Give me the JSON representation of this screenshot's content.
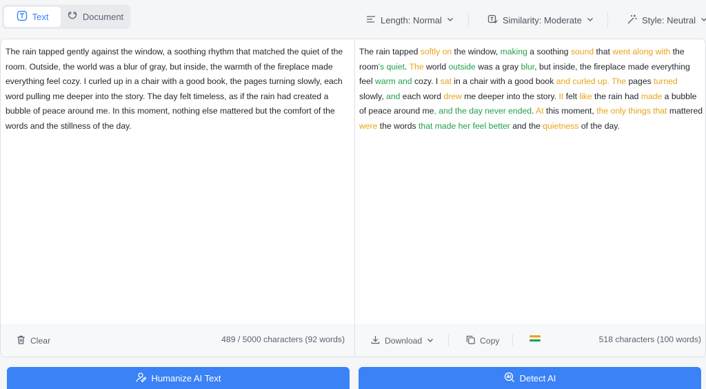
{
  "modes": {
    "text_label": "Text",
    "document_label": "Document"
  },
  "options": {
    "length": "Length: Normal",
    "similarity": "Similarity: Moderate",
    "style": "Style: Neutral"
  },
  "input": {
    "text": "The rain tapped gently against the window, a soothing rhythm that matched the quiet of the room. Outside, the world was a blur of gray, but inside, the warmth of the fireplace made everything feel cozy. I curled up in a chair with a good book, the pages turning slowly, each word pulling me deeper into the story. The day felt timeless, as if the rain had created a bubble of peace around me. In this moment, nothing else mattered but the comfort of the words and the stillness of the day.",
    "clear_label": "Clear",
    "count": "489 / 5000 characters (92 words)"
  },
  "output": {
    "segments": [
      {
        "t": "The rain tapped ",
        "c": ""
      },
      {
        "t": "softly on",
        "c": "o"
      },
      {
        "t": " the window, ",
        "c": ""
      },
      {
        "t": "making",
        "c": "g"
      },
      {
        "t": " a soothing ",
        "c": ""
      },
      {
        "t": "sound",
        "c": "o"
      },
      {
        "t": " that ",
        "c": ""
      },
      {
        "t": "went along with",
        "c": "o"
      },
      {
        "t": " the room",
        "c": ""
      },
      {
        "t": "'s quiet",
        "c": "g"
      },
      {
        "t": ". ",
        "c": ""
      },
      {
        "t": "The",
        "c": "o"
      },
      {
        "t": " world ",
        "c": ""
      },
      {
        "t": "outside",
        "c": "g"
      },
      {
        "t": " was a gray ",
        "c": ""
      },
      {
        "t": "blur",
        "c": "g"
      },
      {
        "t": ", but inside, the fireplace made everything feel ",
        "c": ""
      },
      {
        "t": "warm and",
        "c": "g"
      },
      {
        "t": " cozy. I ",
        "c": ""
      },
      {
        "t": "sat",
        "c": "o"
      },
      {
        "t": " in a chair with a good book ",
        "c": ""
      },
      {
        "t": "and curled up. The",
        "c": "o"
      },
      {
        "t": " pages ",
        "c": ""
      },
      {
        "t": "turned",
        "c": "o"
      },
      {
        "t": " slowly, ",
        "c": ""
      },
      {
        "t": "and",
        "c": "g"
      },
      {
        "t": " each word ",
        "c": ""
      },
      {
        "t": "drew",
        "c": "o"
      },
      {
        "t": " me deeper into the story. ",
        "c": ""
      },
      {
        "t": "It",
        "c": "o"
      },
      {
        "t": " felt ",
        "c": ""
      },
      {
        "t": "like",
        "c": "o"
      },
      {
        "t": " the rain had ",
        "c": ""
      },
      {
        "t": "made",
        "c": "o"
      },
      {
        "t": " a bubble of peace around me",
        "c": ""
      },
      {
        "t": ", and the day never ended",
        "c": "g"
      },
      {
        "t": ". ",
        "c": ""
      },
      {
        "t": "At",
        "c": "o"
      },
      {
        "t": " this moment, ",
        "c": ""
      },
      {
        "t": "the only things that",
        "c": "o"
      },
      {
        "t": " mattered ",
        "c": ""
      },
      {
        "t": "were",
        "c": "o"
      },
      {
        "t": " the words ",
        "c": ""
      },
      {
        "t": "that made her feel better",
        "c": "g"
      },
      {
        "t": " and the ",
        "c": ""
      },
      {
        "t": "quietness",
        "c": "o"
      },
      {
        "t": " of the day.",
        "c": ""
      }
    ],
    "download_label": "Download",
    "copy_label": "Copy",
    "count": "518 characters (100 words)"
  },
  "actions": {
    "humanize_label": "Humanize AI Text",
    "detect_label": "Detect AI"
  },
  "colors": {
    "accent": "#3b82f6",
    "changed_orange": "#e8a317",
    "changed_green": "#22a04b"
  }
}
